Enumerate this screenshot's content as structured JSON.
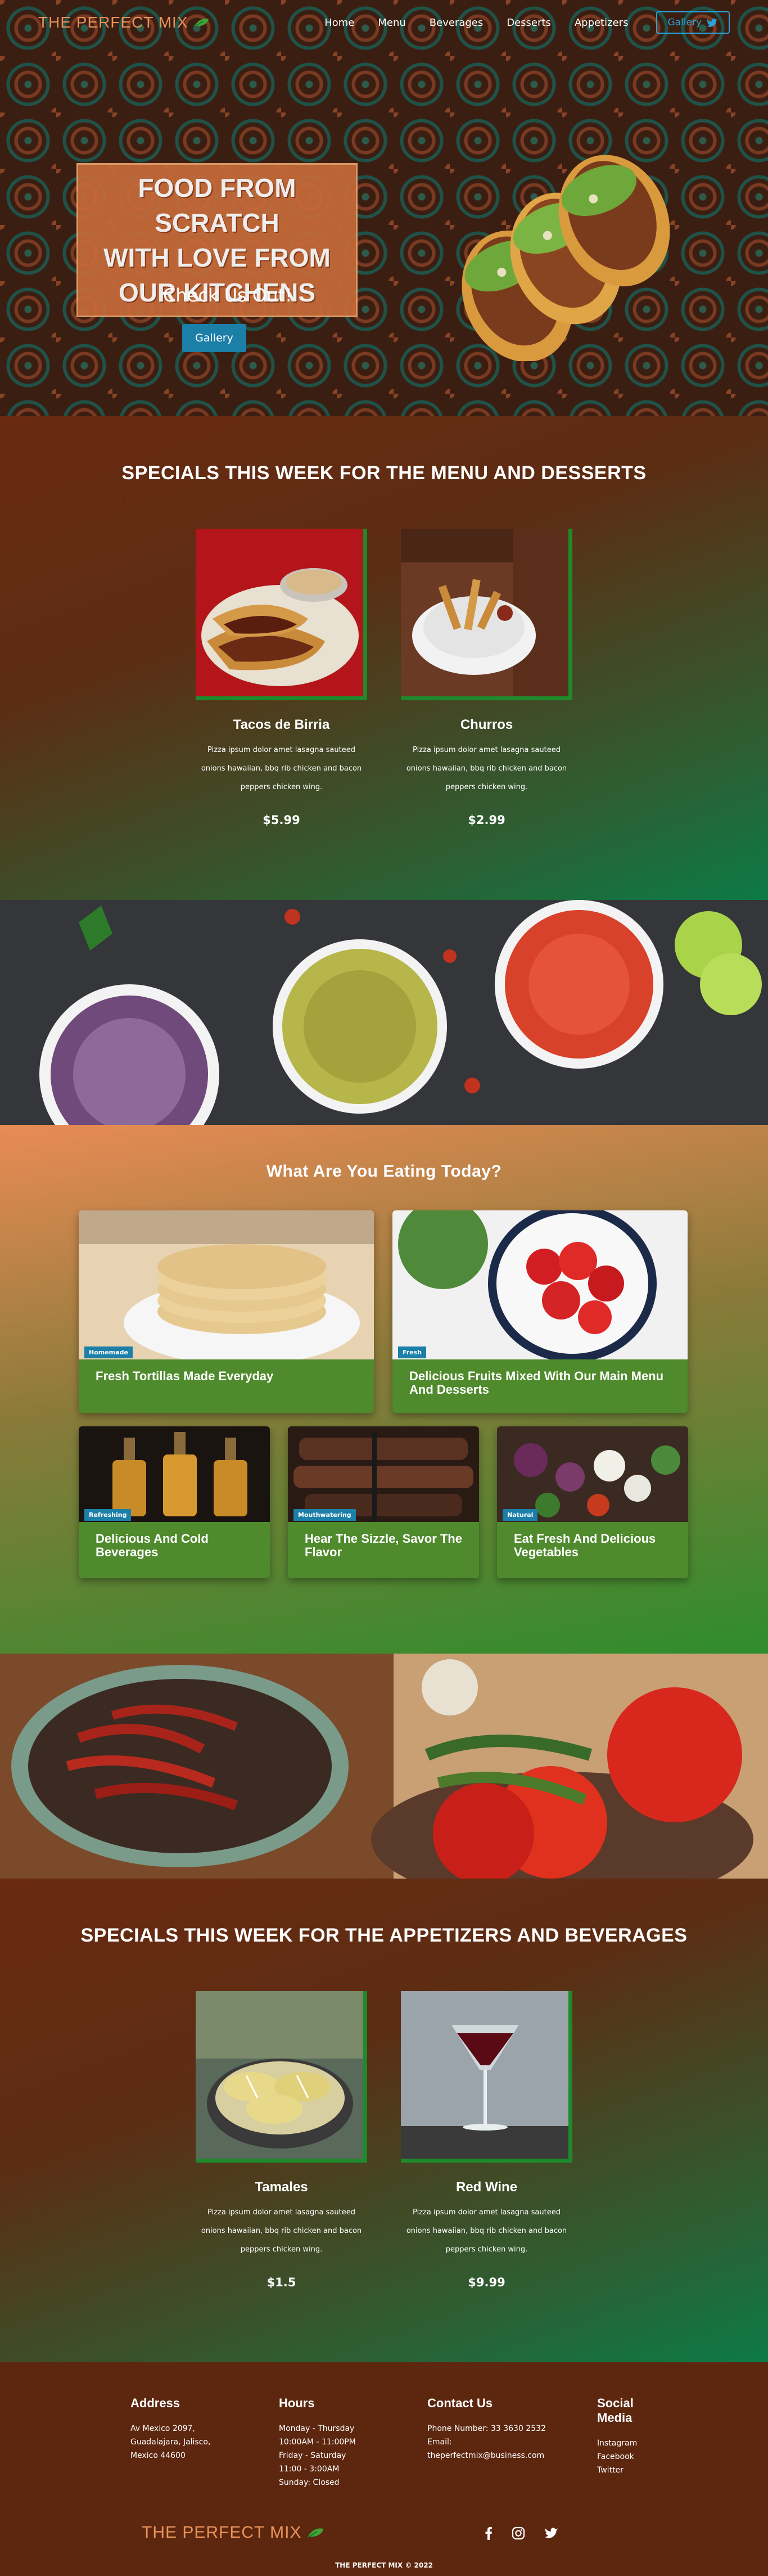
{
  "nav": {
    "logo": "THE PERFECT MIX",
    "items": [
      "Home",
      "Menu",
      "Beverages",
      "Desserts",
      "Appetizers"
    ],
    "gallery_button": "Gallery"
  },
  "hero": {
    "title_line1": "FOOD FROM SCRATCH",
    "title_line2": "WITH LOVE FROM",
    "title_line3": "OUR KITCHENS",
    "subtitle": "Check Us Out!",
    "button": "Gallery"
  },
  "specials_menu": {
    "title": "SPECIALS THIS WEEK FOR THE MENU AND DESSERTS",
    "items": [
      {
        "name": "Tacos de Birria",
        "desc": "Pizza ipsum dolor amet lasagna sauteed onions hawaiian, bbq rib chicken and bacon peppers chicken wing.",
        "price": "$5.99"
      },
      {
        "name": "Churros",
        "desc": "Pizza ipsum dolor amet lasagna sauteed onions hawaiian, bbq rib chicken and bacon peppers chicken wing.",
        "price": "$2.99"
      }
    ]
  },
  "eating": {
    "title": "What Are You Eating Today?",
    "cards": [
      {
        "tag": "Homemade",
        "text": "Fresh Tortillas Made Everyday"
      },
      {
        "tag": "Fresh",
        "text": "Delicious Fruits Mixed With Our Main Menu And Desserts"
      },
      {
        "tag": "Refreshing",
        "text": "Delicious And Cold Beverages"
      },
      {
        "tag": "Mouthwatering",
        "text": "Hear The Sizzle, Savor The Flavor"
      },
      {
        "tag": "Natural",
        "text": "Eat Fresh And Delicious Vegetables"
      }
    ]
  },
  "specials_appetizers": {
    "title": "SPECIALS THIS WEEK FOR THE APPETIZERS AND BEVERAGES",
    "items": [
      {
        "name": "Tamales",
        "desc": "Pizza ipsum dolor amet lasagna sauteed onions hawaiian, bbq rib chicken and bacon peppers chicken wing.",
        "price": "$1.5"
      },
      {
        "name": "Red Wine",
        "desc": "Pizza ipsum dolor amet lasagna sauteed onions hawaiian, bbq rib chicken and bacon peppers chicken wing.",
        "price": "$9.99"
      }
    ]
  },
  "footer": {
    "address": {
      "title": "Address",
      "lines": [
        "Av Mexico 2097,",
        "Guadalajara, Jalisco,",
        "Mexico 44600"
      ]
    },
    "hours": {
      "title": "Hours",
      "lines": [
        "Monday - Thursday",
        "10:00AM - 11:00PM",
        "Friday - Saturday",
        "11:00 - 3:00AM",
        "Sunday: Closed"
      ]
    },
    "contact": {
      "title": "Contact Us",
      "lines": [
        "Phone Number: 33 3630 2532",
        "Email:",
        "theperfectmix@business.com"
      ]
    },
    "social": {
      "title_line1": "Social",
      "title_line2": "Media",
      "lines": [
        "Instagram",
        "Facebook",
        "Twitter"
      ]
    },
    "logo": "THE PERFECT MIX",
    "copyright": "THE PERFECT MIX © 2022"
  },
  "colors": {
    "brand": "#e8925a",
    "accent": "#1c7fa8",
    "green": "#1f8a2b",
    "bg": "#5c260f"
  },
  "icons": [
    "leaf-icon",
    "bird-icon",
    "facebook-icon",
    "instagram-icon",
    "twitter-icon"
  ]
}
